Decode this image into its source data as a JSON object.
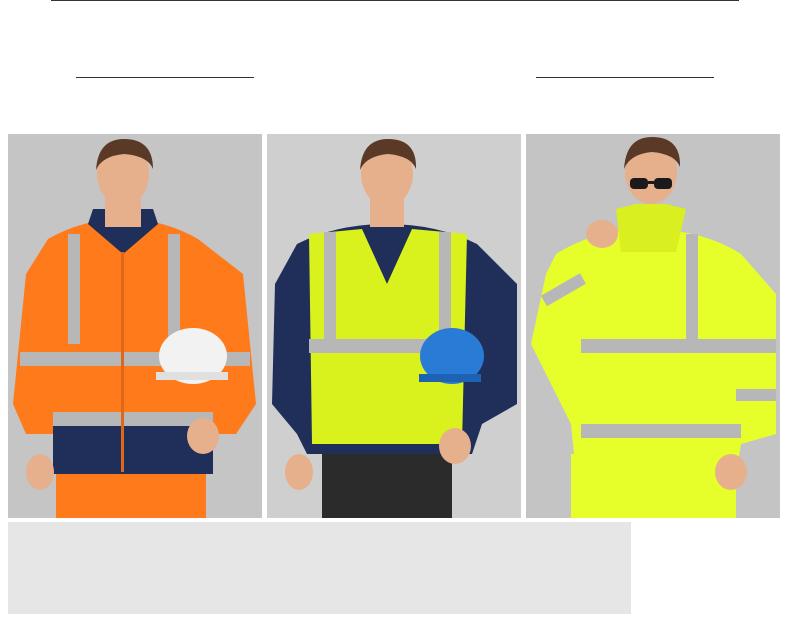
{
  "colors": {
    "background": "#ffffff",
    "rule": "#333333",
    "wall": "#c9c9c9",
    "skin": "#e6b08d",
    "hair": "#5a3a26",
    "reflective": "#b7b7b7",
    "navy": "#1f2f5a",
    "orange": "#ff7a1a",
    "lime": "#d9f21d",
    "neon_yellow": "#e6ff2a",
    "helmet_white": "#f2f2f2",
    "helmet_blue": "#2a7bd6",
    "dark_pants": "#2b2b2b",
    "gray_block": "#e6e6e6"
  },
  "photos": [
    {
      "id": "orange-jacket",
      "icon": "orange-hi-vis-jacket-photo"
    },
    {
      "id": "lime-vest",
      "icon": "lime-hi-vis-vest-photo"
    },
    {
      "id": "yellow-jacket",
      "icon": "yellow-hi-vis-jacket-photo"
    }
  ]
}
